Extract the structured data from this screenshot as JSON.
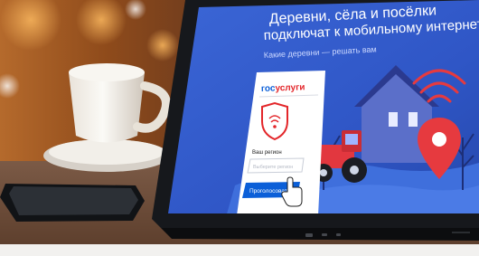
{
  "headline": {
    "line1": "Деревни, сёла и посёлки",
    "line2": "подключат к мобильному интернету"
  },
  "subheadline": "Какие деревни — решать вам",
  "card": {
    "logo_part1": "гос",
    "logo_part2": "услуги",
    "region_label": "Ваш регион",
    "region_placeholder": "Выберите регион",
    "vote_button": "Проголосовать"
  },
  "colors": {
    "screen_blue": "#2f56c6",
    "brand_blue": "#0b5fd8",
    "brand_red": "#e3262a",
    "tractor_red": "#e2373f",
    "pin_red": "#e63a3f"
  }
}
